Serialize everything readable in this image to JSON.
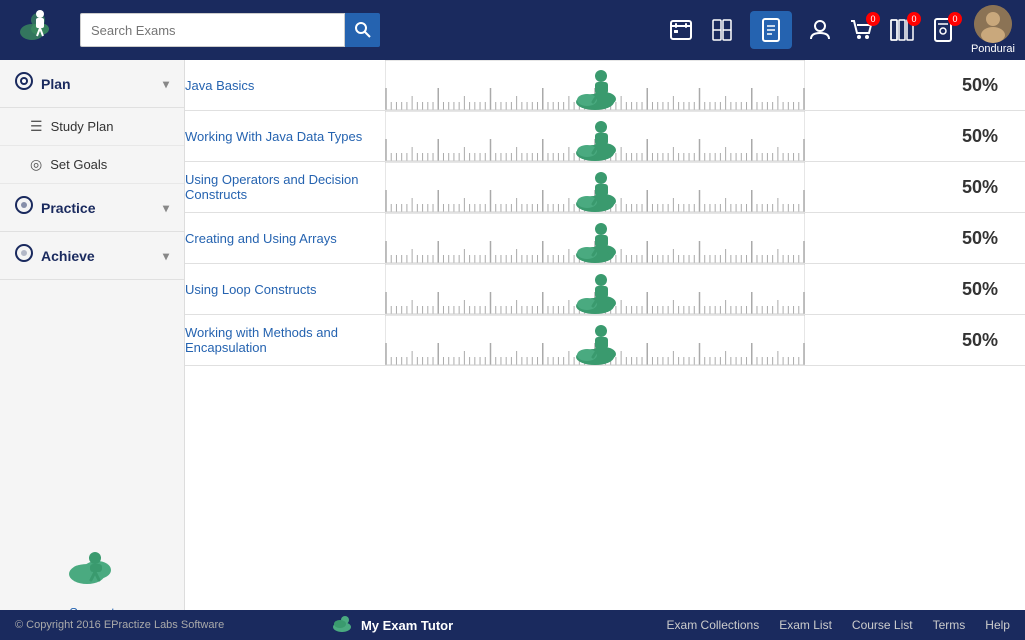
{
  "header": {
    "search_placeholder": "Search Exams",
    "username": "Pondurai",
    "cart_badge": "0",
    "books_badge": "0"
  },
  "sidebar": {
    "plan_label": "Plan",
    "study_plan_label": "Study Plan",
    "set_goals_label": "Set Goals",
    "practice_label": "Practice",
    "achieve_label": "Achieve",
    "support_label": "Support"
  },
  "table": {
    "rows": [
      {
        "topic": "Java Basics",
        "score": "50%"
      },
      {
        "topic": "Working With Java Data Types",
        "score": "50%"
      },
      {
        "topic": "Using Operators and Decision Constructs",
        "score": "50%"
      },
      {
        "topic": "Creating and Using Arrays",
        "score": "50%"
      },
      {
        "topic": "Using Loop Constructs",
        "score": "50%"
      },
      {
        "topic": "Working with Methods and Encapsulation",
        "score": "50%"
      }
    ]
  },
  "footer": {
    "copyright": "© Copyright 2016 EPractize Labs Software",
    "brand": "My Exam Tutor",
    "links": [
      "Exam Collections",
      "Exam List",
      "Course List",
      "Terms",
      "Help"
    ]
  }
}
